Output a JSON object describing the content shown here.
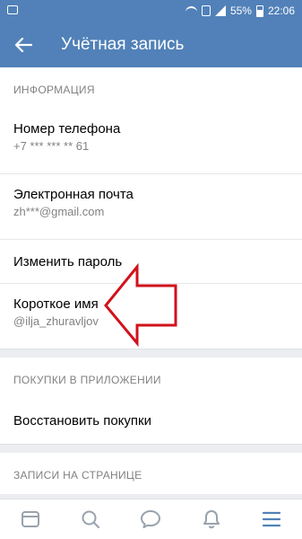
{
  "status_bar": {
    "battery": "55%",
    "time": "22:06",
    "icons": [
      "image-icon",
      "wifi-icon",
      "sim-icon",
      "signal-icon",
      "battery-icon"
    ]
  },
  "header": {
    "title": "Учётная запись",
    "back_icon": "back-arrow-icon"
  },
  "sections": {
    "info": {
      "heading": "ИНФОРМАЦИЯ",
      "phone": {
        "title": "Номер телефона",
        "value": "+7 *** *** ** 61"
      },
      "email": {
        "title": "Электронная почта",
        "value": "zh***@gmail.com"
      },
      "password": {
        "title": "Изменить пароль"
      },
      "short_name": {
        "title": "Короткое имя",
        "value": "@ilja_zhuravljov"
      }
    },
    "purchases": {
      "heading": "ПОКУПКИ В ПРИЛОЖЕНИИ",
      "restore": {
        "title": "Восстановить покупки"
      }
    },
    "posts": {
      "heading": "ЗАПИСИ НА СТРАНИЦЕ"
    }
  },
  "tab_bar": {
    "tabs": [
      "news-icon",
      "search-icon",
      "messages-icon",
      "notifications-icon",
      "menu-icon"
    ],
    "active": "menu-icon"
  },
  "colors": {
    "brand": "#5181b8",
    "background": "#ebedf0",
    "secondary_text": "#828282",
    "annotation_arrow": "#d0121b"
  }
}
